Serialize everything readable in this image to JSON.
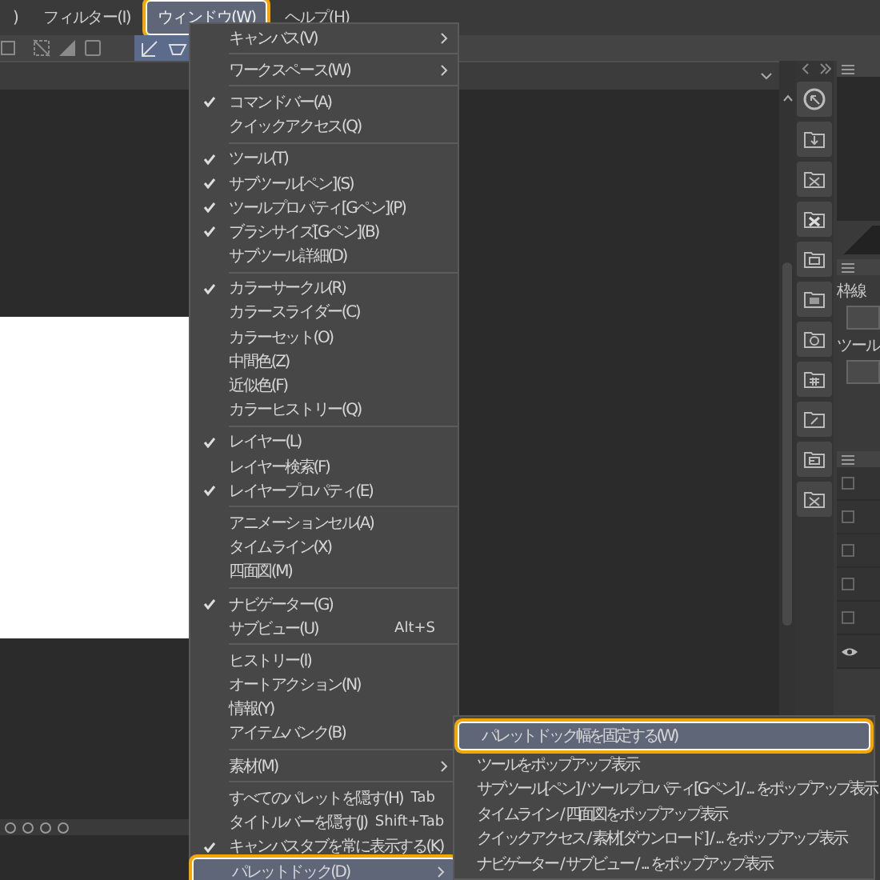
{
  "menubar": [
    {
      "label": ")",
      "selected": false
    },
    {
      "label": "フィルター(I)",
      "selected": false
    },
    {
      "label": "ウィンドウ(W)",
      "selected": true
    },
    {
      "label": "ヘルプ(H)",
      "selected": false
    }
  ],
  "window_menu": {
    "items": [
      {
        "kind": "item",
        "label": "キャンバス(V)",
        "checked": false,
        "submenu": true,
        "selected": false
      },
      {
        "kind": "separator"
      },
      {
        "kind": "item",
        "label": "ワークスペース(W)",
        "checked": false,
        "submenu": true,
        "selected": false
      },
      {
        "kind": "separator"
      },
      {
        "kind": "item",
        "label": "コマンドバー(A)",
        "checked": true,
        "submenu": false,
        "selected": false
      },
      {
        "kind": "item",
        "label": "クイックアクセス(Q)",
        "checked": false,
        "submenu": false,
        "selected": false
      },
      {
        "kind": "separator"
      },
      {
        "kind": "item",
        "label": "ツール(T)",
        "checked": true,
        "submenu": false,
        "selected": false
      },
      {
        "kind": "item",
        "label": "サブツール[ペン](S)",
        "checked": true,
        "submenu": false,
        "selected": false
      },
      {
        "kind": "item",
        "label": "ツールプロパティ[Gペン](P)",
        "checked": true,
        "submenu": false,
        "selected": false
      },
      {
        "kind": "item",
        "label": "ブラシサイズ[Gペン](B)",
        "checked": true,
        "submenu": false,
        "selected": false
      },
      {
        "kind": "item",
        "label": "サブツール詳細(D)",
        "checked": false,
        "submenu": false,
        "selected": false
      },
      {
        "kind": "separator"
      },
      {
        "kind": "item",
        "label": "カラーサークル(R)",
        "checked": true,
        "submenu": false,
        "selected": false
      },
      {
        "kind": "item",
        "label": "カラースライダー(C)",
        "checked": false,
        "submenu": false,
        "selected": false
      },
      {
        "kind": "item",
        "label": "カラーセット(O)",
        "checked": false,
        "submenu": false,
        "selected": false
      },
      {
        "kind": "item",
        "label": "中間色(Z)",
        "checked": false,
        "submenu": false,
        "selected": false
      },
      {
        "kind": "item",
        "label": "近似色(F)",
        "checked": false,
        "submenu": false,
        "selected": false
      },
      {
        "kind": "item",
        "label": "カラーヒストリー(Q)",
        "checked": false,
        "submenu": false,
        "selected": false
      },
      {
        "kind": "separator"
      },
      {
        "kind": "item",
        "label": "レイヤー(L)",
        "checked": true,
        "submenu": false,
        "selected": false
      },
      {
        "kind": "item",
        "label": "レイヤー検索(F)",
        "checked": false,
        "submenu": false,
        "selected": false
      },
      {
        "kind": "item",
        "label": "レイヤープロパティ(E)",
        "checked": true,
        "submenu": false,
        "selected": false
      },
      {
        "kind": "separator"
      },
      {
        "kind": "item",
        "label": "アニメーションセル(A)",
        "checked": false,
        "submenu": false,
        "selected": false
      },
      {
        "kind": "item",
        "label": "タイムライン(X)",
        "checked": false,
        "submenu": false,
        "selected": false
      },
      {
        "kind": "item",
        "label": "四面図(M)",
        "checked": false,
        "submenu": false,
        "selected": false
      },
      {
        "kind": "separator"
      },
      {
        "kind": "item",
        "label": "ナビゲーター(G)",
        "checked": true,
        "submenu": false,
        "selected": false
      },
      {
        "kind": "item",
        "label": "サブビュー(U)",
        "shortcut": "Alt+S",
        "checked": false,
        "submenu": false,
        "selected": false
      },
      {
        "kind": "separator"
      },
      {
        "kind": "item",
        "label": "ヒストリー(I)",
        "checked": false,
        "submenu": false,
        "selected": false
      },
      {
        "kind": "item",
        "label": "オートアクション(N)",
        "checked": false,
        "submenu": false,
        "selected": false
      },
      {
        "kind": "item",
        "label": "情報(Y)",
        "checked": false,
        "submenu": false,
        "selected": false
      },
      {
        "kind": "item",
        "label": "アイテムバンク(B)",
        "checked": false,
        "submenu": false,
        "selected": false
      },
      {
        "kind": "separator"
      },
      {
        "kind": "item",
        "label": "素材(M)",
        "checked": false,
        "submenu": true,
        "selected": false
      },
      {
        "kind": "separator"
      },
      {
        "kind": "item",
        "label": "すべてのパレットを隠す(H)",
        "shortcut": "Tab",
        "checked": false,
        "submenu": false,
        "selected": false
      },
      {
        "kind": "item",
        "label": "タイトルバーを隠す(J)",
        "shortcut": "Shift+Tab",
        "checked": false,
        "submenu": false,
        "selected": false
      },
      {
        "kind": "item",
        "label": "キャンバスタブを常に表示する(K)",
        "checked": true,
        "submenu": false,
        "selected": false
      },
      {
        "kind": "item",
        "label": "パレットドック(D)",
        "checked": false,
        "submenu": true,
        "selected": true
      }
    ]
  },
  "palette_dock_submenu": {
    "items": [
      {
        "label": "パレットドック幅を固定する(W)",
        "selected": true
      },
      {
        "label": "ツールをポップアップ表示",
        "selected": false
      },
      {
        "label": "サブツール[ペン] / ツールプロパティ[Gペン] / ... をポップアップ表示",
        "selected": false
      },
      {
        "label": "タイムライン / 四面図をポップアップ表示",
        "selected": false
      },
      {
        "label": "クイックアクセス / 素材[ダウンロード] / ... をポップアップ表示",
        "selected": false
      },
      {
        "label": "ナビゲーター / サブビュー / ... をポップアップ表示",
        "selected": false
      }
    ]
  },
  "side_panel": {
    "labels": [
      "枠線",
      "ツール"
    ]
  }
}
